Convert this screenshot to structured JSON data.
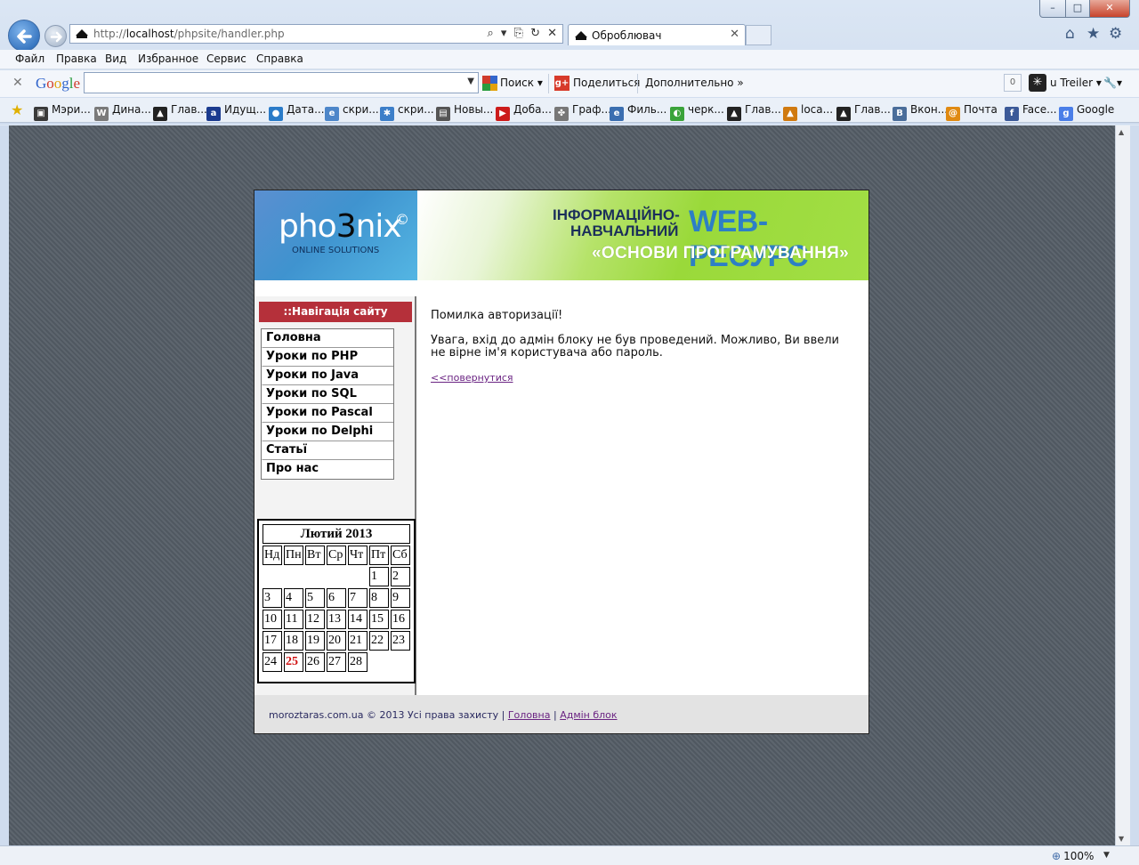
{
  "browser": {
    "window_controls": {
      "minimize": "–",
      "maximize": "□",
      "close": "✕"
    },
    "address": {
      "prefix": "http://",
      "host": "localhost",
      "path": "/phpsite/handler.php",
      "tools": "⌕ ▾ ⎘ ↻ ✕"
    },
    "tab": {
      "title": "Оброблювач"
    },
    "menu": [
      "Файл",
      "Правка",
      "Вид",
      "Избранное",
      "Сервис",
      "Справка"
    ],
    "google_toolbar": {
      "logo": [
        "G",
        "o",
        "o",
        "g",
        "l",
        "e"
      ],
      "search_value": "",
      "search_label": "Поиск",
      "share_label": "Поделиться",
      "more_label": "Дополнительно",
      "counter": "0",
      "user_label": "u Treiler"
    },
    "favorites": [
      {
        "label": "Мэри...",
        "color": "#3a3a3a",
        "glyph": "▣"
      },
      {
        "label": "Дина...",
        "color": "#7a7a7a",
        "glyph": "W"
      },
      {
        "label": "Глав...",
        "color": "#222222",
        "glyph": "▲"
      },
      {
        "label": "Идущ...",
        "color": "#1b3b8f",
        "glyph": "a"
      },
      {
        "label": "Дата...",
        "color": "#2a7bc8",
        "glyph": "●"
      },
      {
        "label": "скри...",
        "color": "#4d86c9",
        "glyph": "e"
      },
      {
        "label": "скри...",
        "color": "#3d7fc9",
        "glyph": "✱"
      },
      {
        "label": "Новы...",
        "color": "#555555",
        "glyph": "▤"
      },
      {
        "label": "Доба...",
        "color": "#cc1b1b",
        "glyph": "▶"
      },
      {
        "label": "Граф...",
        "color": "#777777",
        "glyph": "✤"
      },
      {
        "label": "Филь...",
        "color": "#3b6eb0",
        "glyph": "e"
      },
      {
        "label": "черк...",
        "color": "#3aa33a",
        "glyph": "◐"
      },
      {
        "label": "Глав...",
        "color": "#222222",
        "glyph": "▲"
      },
      {
        "label": "loca...",
        "color": "#d07a10",
        "glyph": "▲"
      },
      {
        "label": "Глав...",
        "color": "#222222",
        "glyph": "▲"
      },
      {
        "label": "Вкон...",
        "color": "#4a6d9a",
        "glyph": "B"
      },
      {
        "label": "Почта",
        "color": "#e08a12",
        "glyph": "@"
      },
      {
        "label": "Face...",
        "color": "#3b5998",
        "glyph": "f"
      },
      {
        "label": "Google",
        "color": "#4a7ee8",
        "glyph": "g"
      }
    ],
    "zoom": "100%"
  },
  "site": {
    "logo": {
      "part1": "pho",
      "three": "3",
      "part2": "nix",
      "copyright": "©",
      "subtitle": "ONLINE SOLUTIONS"
    },
    "banner": {
      "line1": "ІНФОРМАЦІЙНО-",
      "line2": "НАВЧАЛЬНИЙ",
      "web": "WEB-РЕСУРС",
      "line3": "«ОСНОВИ ПРОГРАМУВАННЯ»"
    },
    "nav": {
      "title": "::Навігація сайту",
      "items": [
        "Головна",
        "Уроки по PHP",
        "Уроки по Java",
        "Уроки по SQL",
        "Уроки по Pascal",
        "Уроки по Delphi",
        "Статьї",
        "Про нас"
      ]
    },
    "calendar": {
      "caption": "Лютий 2013",
      "weekdays": [
        "Нд",
        "Пн",
        "Вт",
        "Ср",
        "Чт",
        "Пт",
        "Сб"
      ],
      "weeks": [
        [
          "",
          "",
          "",
          "",
          "",
          "1",
          "2"
        ],
        [
          "3",
          "4",
          "5",
          "6",
          "7",
          "8",
          "9"
        ],
        [
          "10",
          "11",
          "12",
          "13",
          "14",
          "15",
          "16"
        ],
        [
          "17",
          "18",
          "19",
          "20",
          "21",
          "22",
          "23"
        ],
        [
          "24",
          "25",
          "26",
          "27",
          "28",
          "",
          ""
        ]
      ],
      "today": "25"
    },
    "content": {
      "title": "Помилка авторизації!",
      "message": "Увага, вхід до адмін блоку не був проведений. Можливо, Ви ввели не вірне ім'я користувача або пароль.",
      "back_link": "<<повернутися"
    },
    "footer": {
      "copyright": "moroztaras.com.ua © 2013 Усі права захисту",
      "sep": "|",
      "home_link": "Головна",
      "admin_link": "Адмін блок"
    }
  }
}
